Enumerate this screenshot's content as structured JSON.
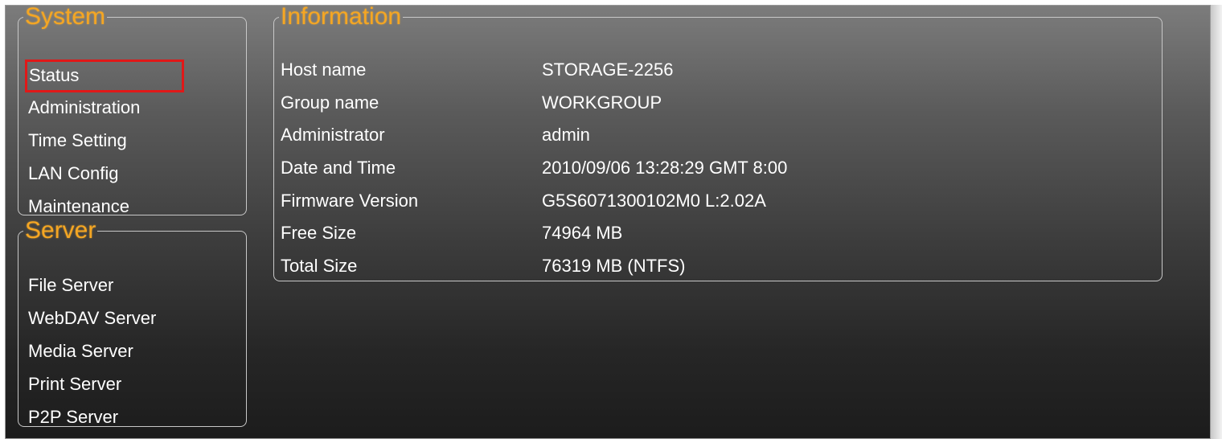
{
  "system": {
    "title": "System",
    "items": [
      {
        "label": "Status",
        "active": true
      },
      {
        "label": "Administration",
        "active": false
      },
      {
        "label": "Time Setting",
        "active": false
      },
      {
        "label": "LAN Config",
        "active": false
      },
      {
        "label": "Maintenance",
        "active": false
      }
    ]
  },
  "server": {
    "title": "Server",
    "items": [
      {
        "label": "File Server"
      },
      {
        "label": "WebDAV Server"
      },
      {
        "label": "Media Server"
      },
      {
        "label": "Print Server"
      },
      {
        "label": "P2P Server"
      }
    ]
  },
  "information": {
    "title": "Information",
    "rows": [
      {
        "label": "Host name",
        "value": "STORAGE-2256"
      },
      {
        "label": "Group name",
        "value": "WORKGROUP"
      },
      {
        "label": "Administrator",
        "value": "admin"
      },
      {
        "label": "Date and Time",
        "value": "2010/09/06 13:28:29 GMT 8:00"
      },
      {
        "label": "Firmware Version",
        "value": "G5S6071300102M0 L:2.02A"
      },
      {
        "label": "Free Size",
        "value": "74964 MB"
      },
      {
        "label": "Total Size",
        "value": "76319 MB (NTFS)"
      }
    ]
  },
  "colors": {
    "legend": "#f5a623",
    "selection_outline": "#e01818",
    "text": "#ffffff"
  }
}
